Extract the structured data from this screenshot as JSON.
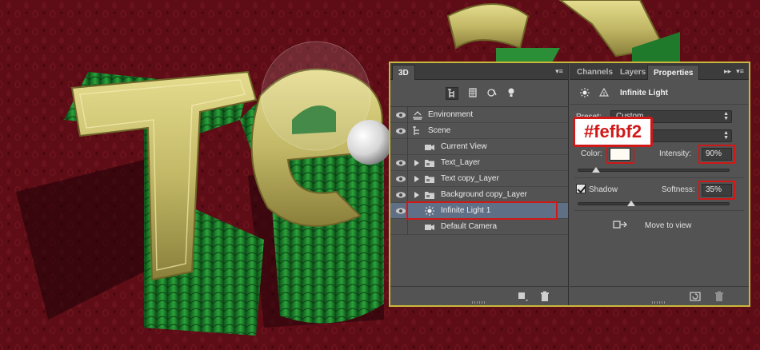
{
  "panel3d": {
    "tab_label": "3D",
    "toolbar_icons": [
      "scene-filter-icon",
      "mesh-filter-icon",
      "material-filter-icon",
      "light-filter-icon"
    ],
    "layers": [
      {
        "label": "Environment",
        "icon": "environment-icon",
        "expandable": false,
        "indent": 0,
        "selected": false
      },
      {
        "label": "Scene",
        "icon": "scene-icon",
        "expandable": false,
        "indent": 0,
        "selected": false
      },
      {
        "label": "Current View",
        "icon": "camera-icon",
        "expandable": false,
        "indent": 1,
        "selected": false
      },
      {
        "label": "Text_Layer",
        "icon": "mesh-folder-icon",
        "expandable": true,
        "indent": 1,
        "selected": false
      },
      {
        "label": "Text copy_Layer",
        "icon": "mesh-folder-icon",
        "expandable": true,
        "indent": 1,
        "selected": false
      },
      {
        "label": "Background copy_Layer",
        "icon": "mesh-folder-icon",
        "expandable": true,
        "indent": 1,
        "selected": false
      },
      {
        "label": "Infinite Light 1",
        "icon": "infinite-light-icon",
        "expandable": false,
        "indent": 1,
        "selected": true
      },
      {
        "label": "Default Camera",
        "icon": "camera-icon",
        "expandable": false,
        "indent": 1,
        "selected": false
      }
    ],
    "footer_icons": [
      "new-light-icon",
      "trash-icon"
    ]
  },
  "properties": {
    "tabs": [
      "Channels",
      "Layers",
      "Properties"
    ],
    "active_tab": "Properties",
    "header_title": "Infinite Light",
    "preset_label": "Preset:",
    "preset_value": "Custom",
    "second_dropdown_value": "",
    "color_label": "Color:",
    "color_value": "#fefbf2",
    "intensity_label": "Intensity:",
    "intensity_value": "90%",
    "intensity_level": 0.9,
    "shadow_label": "Shadow",
    "shadow_checked": true,
    "softness_label": "Softness:",
    "softness_value": "35%",
    "softness_level": 0.35,
    "move_to_view_label": "Move to view",
    "footer_icons": [
      "reset-view-icon",
      "trash-icon"
    ]
  },
  "callout": {
    "text": "#fefbf2"
  },
  "colors": {
    "panel_bg": "#535353",
    "tab_bar": "#3c3c3c",
    "highlight_border": "#d01818",
    "panel_frame": "#c9b83a",
    "selected_row": "#5f6f86",
    "light_color": "#fefbf2"
  }
}
